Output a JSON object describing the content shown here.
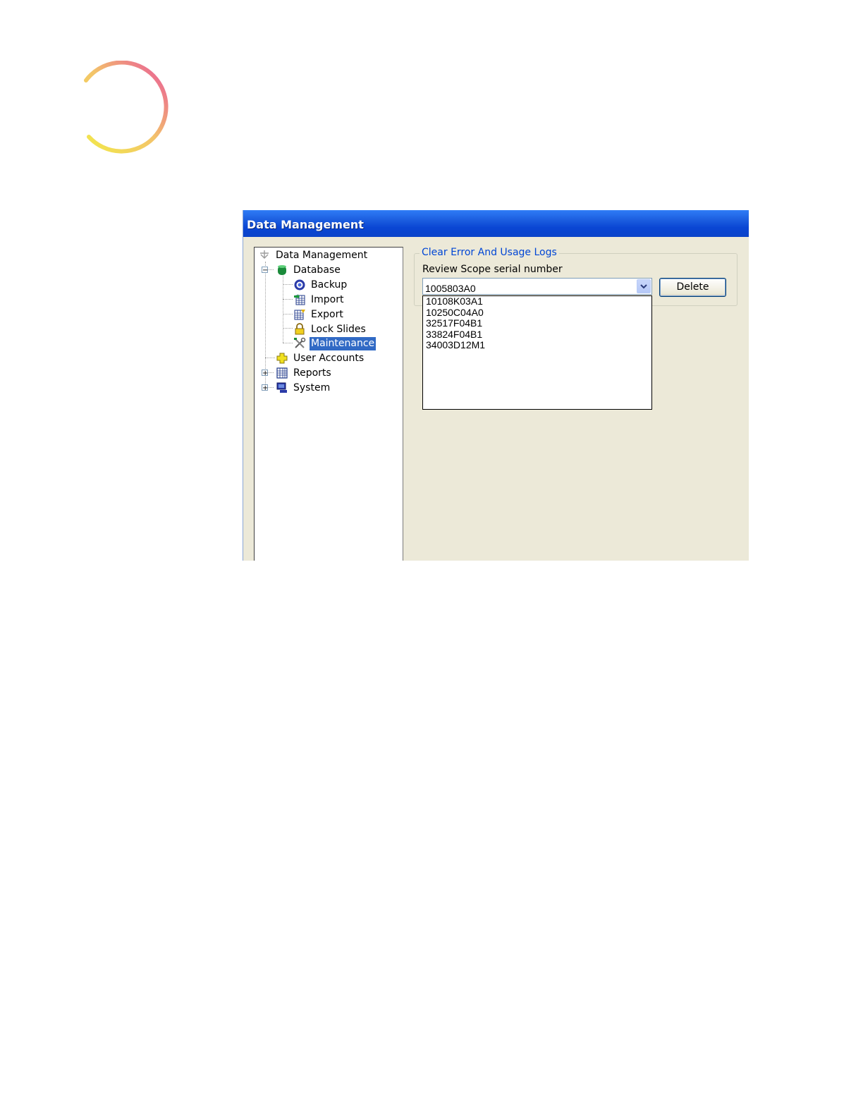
{
  "window": {
    "title": "Data Management"
  },
  "tree": {
    "root": "Data Management",
    "database": "Database",
    "backup": "Backup",
    "import": "Import",
    "export": "Export",
    "lock_slides": "Lock Slides",
    "maintenance": "Maintenance",
    "user_accounts": "User Accounts",
    "reports": "Reports",
    "system": "System"
  },
  "panel": {
    "group_title": "Clear Error And Usage Logs",
    "field_label": "Review Scope serial number",
    "selected_value": "1005803A0",
    "options": [
      "10108K03A1",
      "10250C04A0",
      "32517F04B1",
      "33824F04B1",
      "34003D12M1"
    ],
    "delete_label": "Delete"
  },
  "colors": {
    "title_bar": "#0a46d4",
    "selection": "#316ac5",
    "group_title": "#0046d5"
  }
}
